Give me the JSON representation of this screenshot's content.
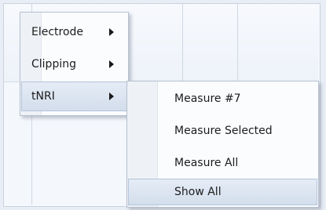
{
  "menu": {
    "items": [
      {
        "label": "Electrode"
      },
      {
        "label": "Clipping"
      },
      {
        "label": "tNRI"
      }
    ]
  },
  "submenu": {
    "items": [
      {
        "label": "Measure #7"
      },
      {
        "label": "Measure Selected"
      },
      {
        "label": "Measure All"
      },
      {
        "label": "Show All"
      }
    ]
  },
  "colors": {
    "menu_bg": "#fbfcfe",
    "highlight": "#d3deec",
    "border": "#b7c1cf"
  },
  "icons": {
    "submenu_arrow": "chevron-right-icon"
  }
}
